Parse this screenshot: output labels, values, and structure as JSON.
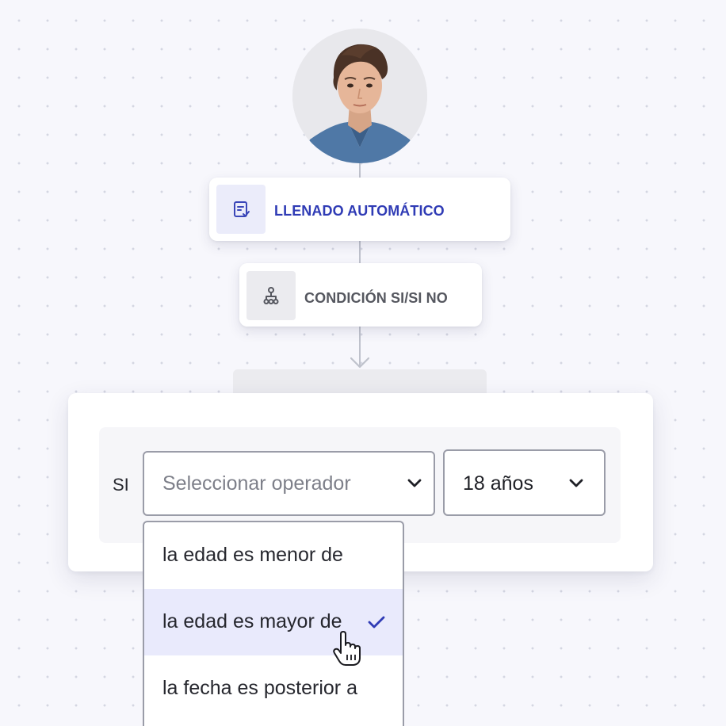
{
  "flow": {
    "avatar_label": "Foto de perfil",
    "step1": {
      "label": "LLENADO AUTOMÁTICO",
      "icon": "form-check-icon"
    },
    "step2": {
      "label": "CONDICIÓN SI/SI NO",
      "icon": "branch-icon"
    }
  },
  "condition": {
    "prefix": "SI",
    "operator_select": {
      "placeholder": "Seleccionar operador",
      "icon": "chevron-down-icon"
    },
    "value_select": {
      "value": "18 años",
      "icon": "chevron-down-icon"
    },
    "options": [
      {
        "label": "la edad es menor de",
        "selected": false
      },
      {
        "label": "la edad es mayor de",
        "selected": true
      },
      {
        "label": "la fecha es posterior a",
        "selected": false
      }
    ]
  },
  "colors": {
    "accent": "#2f3bb5",
    "text_dark": "#26272e",
    "placeholder": "#7d7f89",
    "selected_bg": "#e9eafc"
  }
}
